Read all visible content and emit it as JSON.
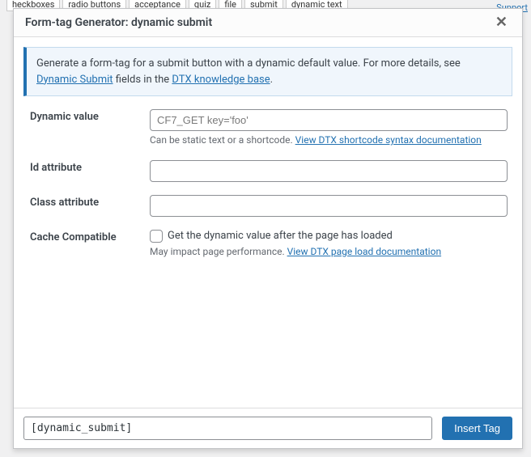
{
  "bg": {
    "tabs": [
      "heckboxes",
      "radio buttons",
      "acceptance",
      "quiz",
      "file",
      "submit",
      "dynamic text"
    ],
    "support": "Support"
  },
  "modal": {
    "title": "Form-tag Generator: dynamic submit",
    "notice": {
      "prefix": "Generate a form-tag for a submit button with a dynamic default value. For more details, see ",
      "link1": "Dynamic Submit",
      "mid": " fields in the ",
      "link2": "DTX knowledge base",
      "suffix": "."
    },
    "fields": {
      "dynamic_value": {
        "label": "Dynamic value",
        "placeholder": "CF7_GET key='foo'",
        "value": "",
        "help_prefix": "Can be static text or a shortcode. ",
        "help_link": "View DTX shortcode syntax documentation"
      },
      "id_attr": {
        "label": "Id attribute",
        "value": ""
      },
      "class_attr": {
        "label": "Class attribute",
        "value": ""
      },
      "cache": {
        "label": "Cache Compatible",
        "cb_label": "Get the dynamic value after the page has loaded",
        "help_prefix": "May impact page performance. ",
        "help_link": "View DTX page load documentation"
      }
    }
  },
  "footer": {
    "tag": "[dynamic_submit]",
    "insert": "Insert Tag"
  }
}
